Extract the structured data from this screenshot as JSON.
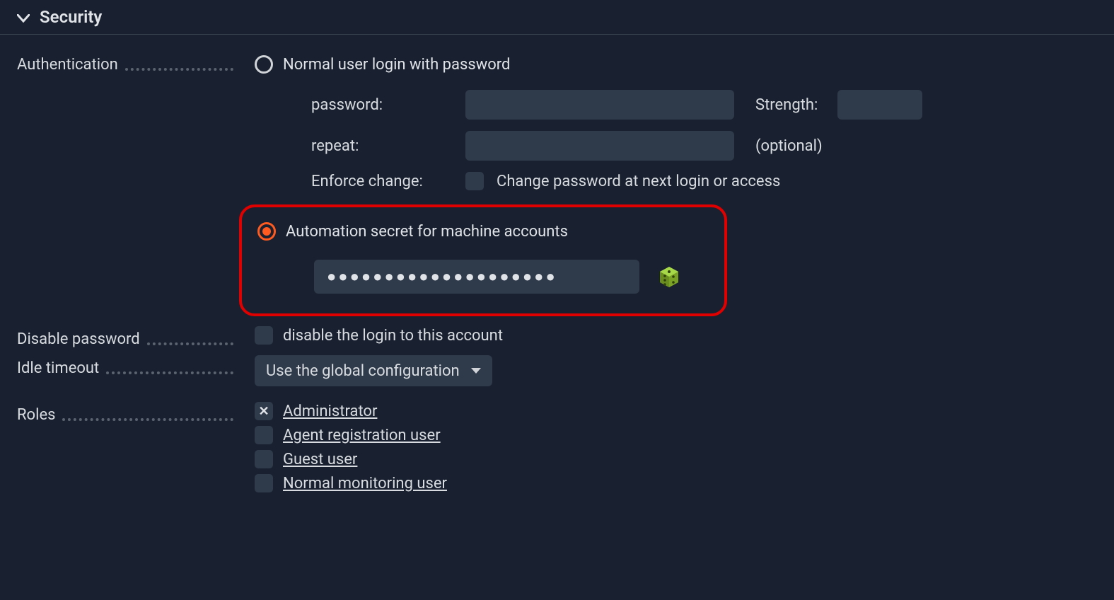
{
  "section": {
    "title": "Security"
  },
  "fields": {
    "authentication": {
      "label": "Authentication",
      "option_normal": "Normal user login with password",
      "password_label": "password:",
      "password_value": "",
      "strength_label": "Strength:",
      "repeat_label": "repeat:",
      "repeat_value": "",
      "optional_label": "(optional)",
      "enforce_label": "Enforce change:",
      "enforce_checkbox_label": "Change password at next login or access",
      "option_automation": "Automation secret for machine accounts",
      "secret_value": "●●●●●●●●●●●●●●●●●●●●"
    },
    "disable_password": {
      "label": "Disable password",
      "checkbox_label": "disable the login to this account"
    },
    "idle_timeout": {
      "label": "Idle timeout",
      "value": "Use the global configuration"
    },
    "roles": {
      "label": "Roles",
      "items": [
        {
          "label": "Administrator",
          "checked": true
        },
        {
          "label": "Agent registration user",
          "checked": false
        },
        {
          "label": "Guest user",
          "checked": false
        },
        {
          "label": "Normal monitoring user",
          "checked": false
        }
      ]
    }
  }
}
